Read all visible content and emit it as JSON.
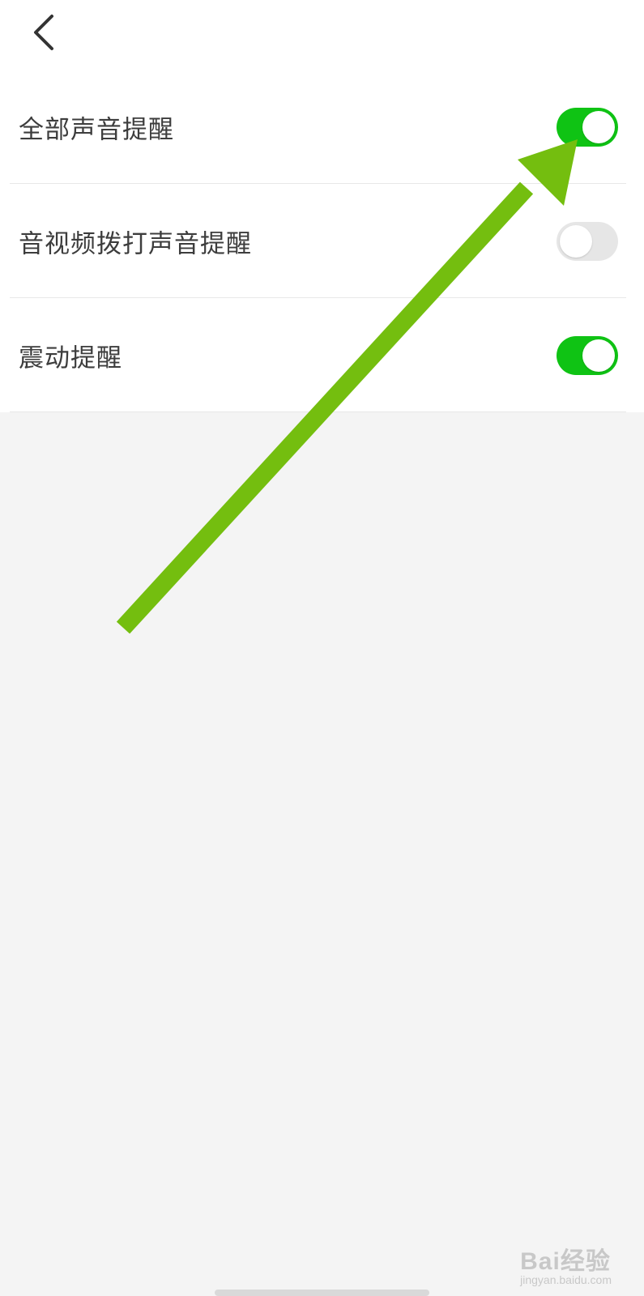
{
  "header": {
    "back_icon": "chevron-left-icon"
  },
  "settings": [
    {
      "label": "全部声音提醒",
      "enabled": true
    },
    {
      "label": "音视频拨打声音提醒",
      "enabled": false
    },
    {
      "label": "震动提醒",
      "enabled": true
    }
  ],
  "colors": {
    "toggle_on": "#0fc314",
    "toggle_off": "#e6e6e6",
    "annotation_arrow": "#74be0f",
    "background": "#f4f4f4"
  },
  "watermark": {
    "main": "Bai经验",
    "sub": "jingyan.baidu.com"
  }
}
